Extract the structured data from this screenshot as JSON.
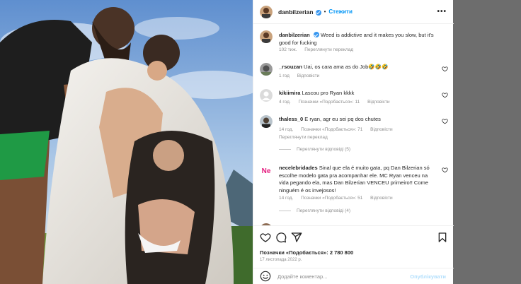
{
  "post": {
    "author": "danbilzerian",
    "follow_label": "Стежити",
    "separator": "•",
    "more_label": "•••",
    "caption": {
      "username": "danbilzerian",
      "text": "Weed is addictive and it makes you slow, but it's good for fucking",
      "time": "102 тиж.",
      "translate": "Переглянути переклад"
    }
  },
  "comments": [
    {
      "username": "_rsouzan",
      "text": "Uai, os cara ama as do Job🤣🤣🤣",
      "time": "1 год",
      "reply": "Відповісти"
    },
    {
      "username": "kikiimira",
      "text": "Lascou pro Ryan kkkk",
      "time": "4 год.",
      "likes": "Позначки «Подобається»: 11",
      "reply": "Відповісти"
    },
    {
      "username": "thaless_0",
      "text": "E ryan, agr eu sei pq dos chutes",
      "time": "14 год.",
      "likes": "Позначки «Подобається»: 71",
      "reply": "Відповісти",
      "translate": "Переглянути переклад",
      "replies": "Переглянути відповіді (5)"
    },
    {
      "username": "necelebridades",
      "text": "Sinal que ela é muito gata, pq Dan Bilzerian só escolhe modelo gata pra acompanhar ele. MC Ryan venceu na vida pegando ela, mas Dan Bilzerian VENCEU primeiro!! Come ninguém é os invejosos!",
      "time": "14 год.",
      "likes": "Позначки «Подобається»: 51",
      "reply": "Відповісти",
      "replies": "Переглянути відповіді (4)"
    }
  ],
  "actions": {
    "likes": "Позначки «Подобається»: 2 780 800",
    "date": "17 листопада 2022 р."
  },
  "composer": {
    "placeholder": "Додайте коментар...",
    "post_label": "Опублікувати"
  },
  "colors": {
    "accent": "#0095f6",
    "verified": "#3897f0",
    "muted": "#8e8e8e"
  }
}
